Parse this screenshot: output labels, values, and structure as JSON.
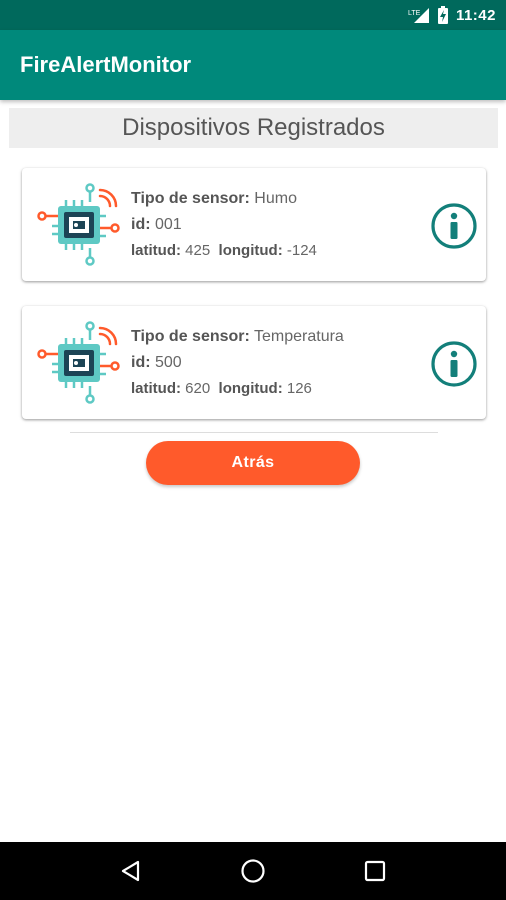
{
  "status_bar": {
    "network_label": "LTE",
    "time": "11:42"
  },
  "app_bar": {
    "title": "FireAlertMonitor"
  },
  "header": {
    "title": "Dispositivos Registrados"
  },
  "labels": {
    "sensor_type": "Tipo de sensor:",
    "id": "id:",
    "latitude": "latitud:",
    "longitude": "longitud:"
  },
  "devices": [
    {
      "sensor_type": "Humo",
      "id": "001",
      "latitude": "425",
      "longitude": "-124"
    },
    {
      "sensor_type": "Temperatura",
      "id": "500",
      "latitude": "620",
      "longitude": "126"
    }
  ],
  "back_button": {
    "label": "Atrás"
  },
  "colors": {
    "status_bar": "#00695c",
    "app_bar": "#00897b",
    "accent": "#ff5a2b",
    "info_icon": "#137f7a"
  },
  "icons": {
    "device": "iot-chip-icon",
    "info": "info-icon",
    "nav_back": "nav-back-icon",
    "nav_home": "nav-home-icon",
    "nav_recents": "nav-recents-icon"
  }
}
